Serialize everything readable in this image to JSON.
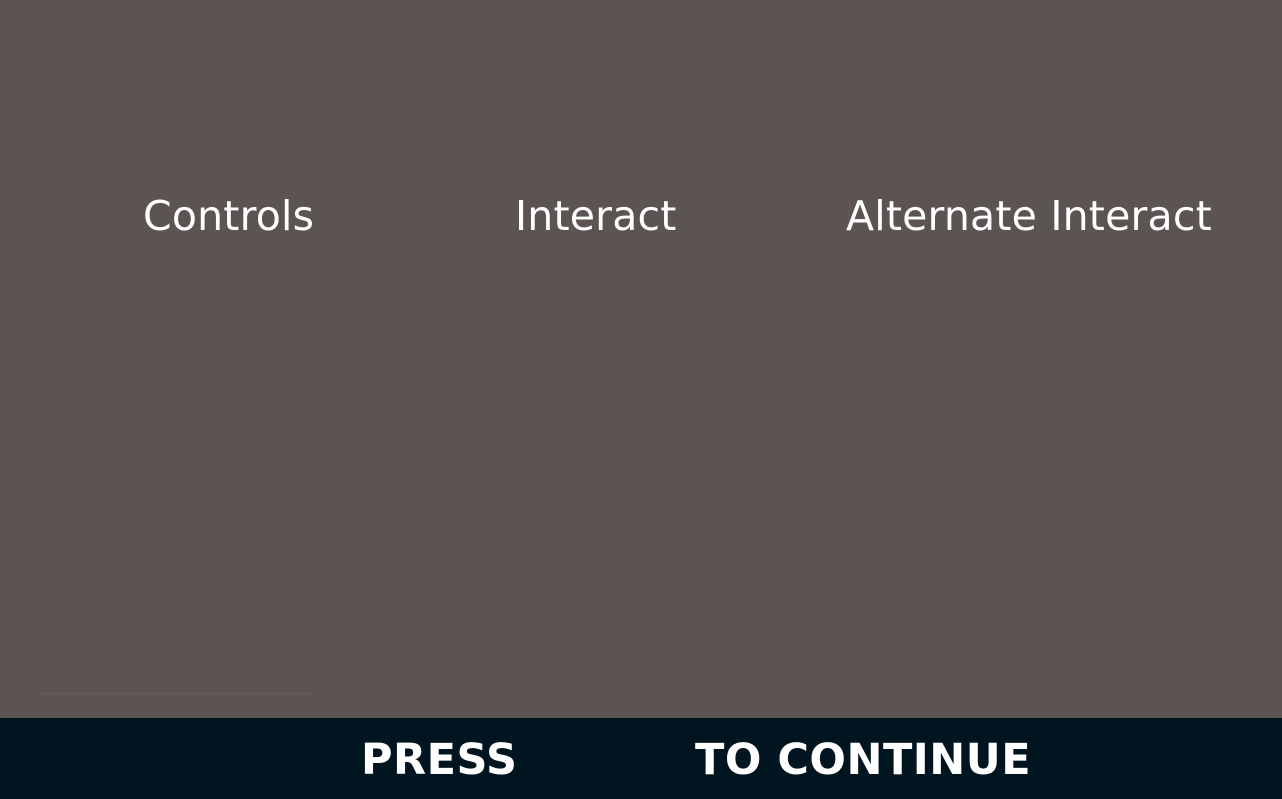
{
  "headings": {
    "controls": "Controls",
    "interact": "Interact",
    "alternate_interact": "Alternate Interact"
  },
  "prompt": {
    "press": "PRESS",
    "to_continue": "TO CONTINUE"
  },
  "colors": {
    "background": "#5c5452",
    "bottom_bar": "#011520",
    "text": "#ffffff"
  }
}
